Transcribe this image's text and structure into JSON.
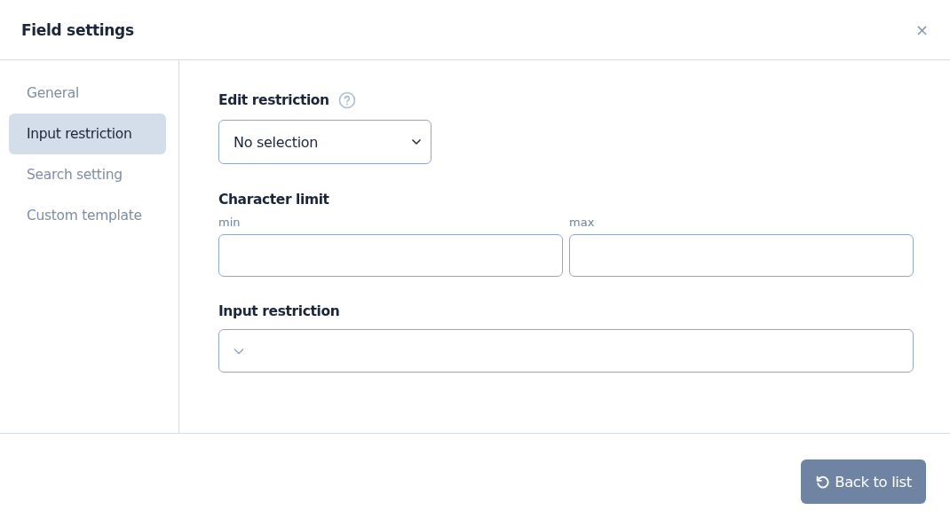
{
  "dialog": {
    "title": "Field settings",
    "close": "×"
  },
  "sidebar": {
    "items": [
      {
        "label": "General",
        "selected": false
      },
      {
        "label": "Input restriction",
        "selected": true
      },
      {
        "label": "Search setting",
        "selected": false
      },
      {
        "label": "Custom template",
        "selected": false
      }
    ]
  },
  "edit_restriction": {
    "label": "Edit restriction",
    "value": "No selection"
  },
  "character_limit": {
    "label": "Character limit",
    "min": {
      "label": "min"
    },
    "max": {
      "label": "max"
    }
  },
  "input_restriction": {
    "label": "Input restriction"
  },
  "footer": {
    "button": "Back to list"
  }
}
